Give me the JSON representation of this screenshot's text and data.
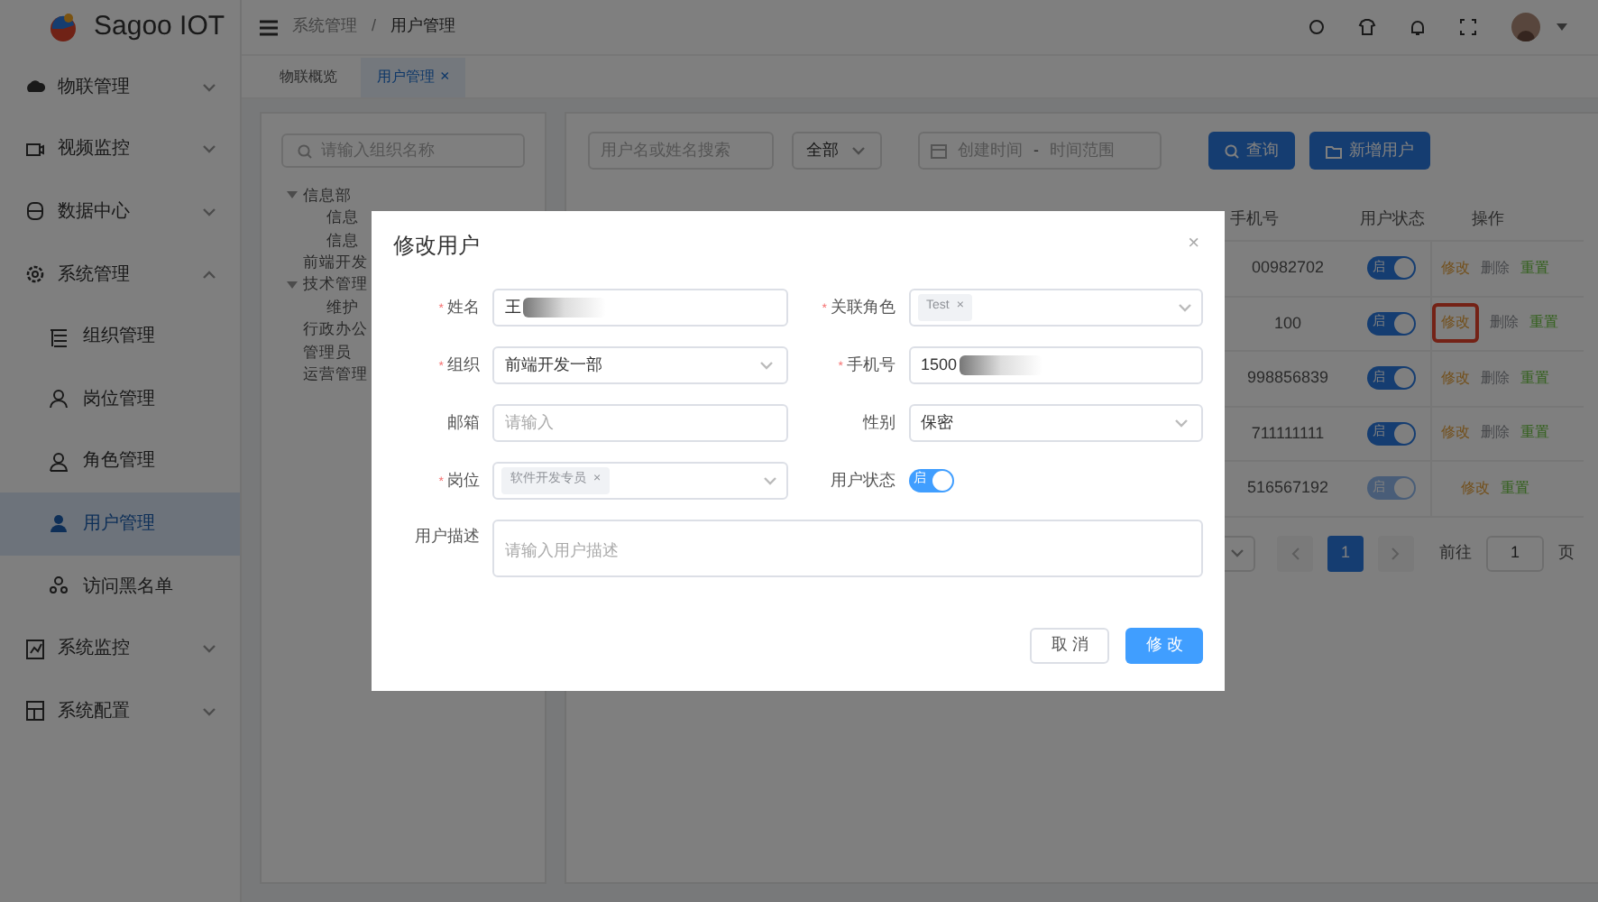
{
  "app": {
    "name": "Sagoo IOT"
  },
  "sidebar": {
    "items": [
      {
        "label": "物联管理",
        "expanded": false,
        "selected": false
      },
      {
        "label": "视频监控",
        "expanded": false,
        "selected": false
      },
      {
        "label": "数据中心",
        "expanded": false,
        "selected": false
      },
      {
        "label": "系统管理",
        "expanded": true,
        "selected": false,
        "children": [
          {
            "label": "组织管理",
            "selected": false
          },
          {
            "label": "岗位管理",
            "selected": false
          },
          {
            "label": "角色管理",
            "selected": false
          },
          {
            "label": "用户管理",
            "selected": true
          },
          {
            "label": "访问黑名单",
            "selected": false
          }
        ]
      },
      {
        "label": "系统监控",
        "expanded": false,
        "selected": false
      },
      {
        "label": "系统配置",
        "expanded": false,
        "selected": false
      }
    ]
  },
  "breadcrumb": [
    "系统管理",
    "/",
    "用户管理"
  ],
  "tabs": [
    {
      "label": "物联概览",
      "selected": false
    },
    {
      "label": "用户管理",
      "selected": true,
      "close": "×"
    }
  ],
  "tree": {
    "search_placeholder": "请输入组织名称",
    "items": [
      {
        "label": "信息部",
        "expanded": true,
        "children": [
          {
            "label": "信息"
          },
          {
            "label": "信息"
          }
        ]
      },
      {
        "label": "前端开发"
      },
      {
        "label": "技术管理",
        "expanded": true,
        "children": [
          {
            "label": "维护"
          }
        ]
      },
      {
        "label": "行政办公"
      },
      {
        "label": "管理员"
      },
      {
        "label": "运营管理"
      }
    ]
  },
  "filters": {
    "search_placeholder": "用户名或姓名搜索",
    "status_select": "全部",
    "date_start_placeholder": "创建时间",
    "date_sep": "-",
    "date_end_placeholder": "时间范围",
    "query_button": "查询",
    "add_button": "新增用户"
  },
  "table": {
    "columns": [
      "手机号",
      "用户状态",
      "操作"
    ],
    "rows": [
      {
        "phone": "00982702",
        "on": true,
        "disabled": false,
        "switch_text": "启",
        "actions": [
          {
            "label": "修改",
            "kind": "edit",
            "highlighted": false
          },
          {
            "label": "删除",
            "kind": "delete",
            "highlighted": false
          },
          {
            "label": "重置",
            "kind": "reset",
            "highlighted": false
          }
        ]
      },
      {
        "phone": "100",
        "on": true,
        "disabled": false,
        "switch_text": "启",
        "actions": [
          {
            "label": "修改",
            "kind": "edit",
            "highlighted": true
          },
          {
            "label": "删除",
            "kind": "delete",
            "highlighted": false
          },
          {
            "label": "重置",
            "kind": "reset",
            "highlighted": false
          }
        ]
      },
      {
        "phone": "998856839",
        "on": true,
        "disabled": false,
        "switch_text": "启",
        "actions": [
          {
            "label": "修改",
            "kind": "edit",
            "highlighted": false
          },
          {
            "label": "删除",
            "kind": "delete",
            "highlighted": false
          },
          {
            "label": "重置",
            "kind": "reset",
            "highlighted": false
          }
        ]
      },
      {
        "phone": "711111111",
        "on": true,
        "disabled": false,
        "switch_text": "启",
        "actions": [
          {
            "label": "修改",
            "kind": "edit",
            "highlighted": false
          },
          {
            "label": "删除",
            "kind": "delete",
            "highlighted": false
          },
          {
            "label": "重置",
            "kind": "reset",
            "highlighted": false
          }
        ]
      },
      {
        "phone": "516567192",
        "on": true,
        "disabled": true,
        "switch_text": "启",
        "actions": [
          {
            "label": "修改",
            "kind": "edit",
            "highlighted": false
          },
          {
            "label": "重置",
            "kind": "reset",
            "highlighted": false
          }
        ]
      }
    ]
  },
  "pagination": {
    "page": "1",
    "goto_label": "前往",
    "goto_value": "1",
    "page_suffix": "页"
  },
  "dialog": {
    "title": "修改用户",
    "close": "×",
    "fields": [
      {
        "label": "姓名",
        "required_mark": "*",
        "kind": "text",
        "value": "王",
        "redacted": true
      },
      {
        "label": "关联角色",
        "required_mark": "*",
        "kind": "tags",
        "tags": [
          {
            "label": "Test",
            "close": "×"
          }
        ]
      },
      {
        "label": "组织",
        "required_mark": "*",
        "kind": "select",
        "value": "前端开发一部"
      },
      {
        "label": "手机号",
        "required_mark": "*",
        "kind": "text",
        "value": "1500",
        "redacted": true
      },
      {
        "label": "邮箱",
        "kind": "text",
        "placeholder": "请输入"
      },
      {
        "label": "性别",
        "kind": "select",
        "value": "保密"
      },
      {
        "label": "岗位",
        "required_mark": "*",
        "kind": "tags",
        "tags": [
          {
            "label": "软件开发专员",
            "close": "×"
          }
        ]
      },
      {
        "label": "用户状态",
        "kind": "switch",
        "on": true,
        "switch_text": "启"
      },
      {
        "label": "用户描述",
        "kind": "textarea",
        "placeholder": "请输入用户描述"
      }
    ],
    "cancel": "取 消",
    "submit": "修 改"
  }
}
